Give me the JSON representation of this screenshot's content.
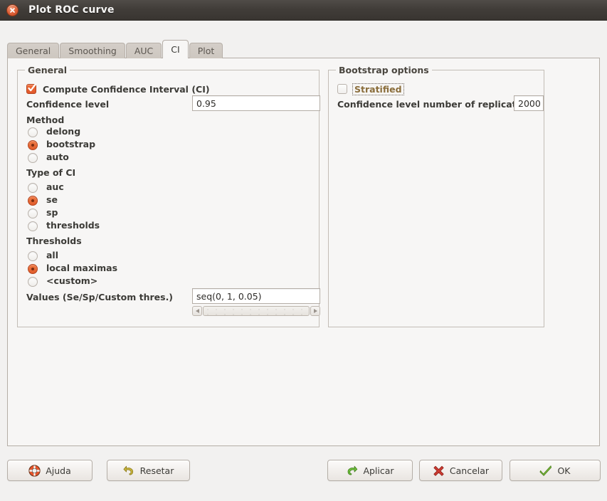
{
  "window": {
    "title": "Plot ROC curve",
    "close_icon": "close-icon"
  },
  "tabs": [
    {
      "label": "General",
      "active": false
    },
    {
      "label": "Smoothing",
      "active": false
    },
    {
      "label": "AUC",
      "active": false
    },
    {
      "label": "CI",
      "active": true
    },
    {
      "label": "Plot",
      "active": false
    }
  ],
  "general_group": {
    "title": "General",
    "compute_ci_label": "Compute Confidence Interval (CI)",
    "compute_ci_checked": true,
    "confidence_level_label": "Confidence level",
    "confidence_level_value": "0.95",
    "method_label": "Method",
    "method_options": [
      {
        "label": "delong",
        "selected": false
      },
      {
        "label": "bootstrap",
        "selected": true
      },
      {
        "label": "auto",
        "selected": false
      }
    ],
    "type_of_ci_label": "Type of CI",
    "type_of_ci_options": [
      {
        "label": "auc",
        "selected": false
      },
      {
        "label": "se",
        "selected": true
      },
      {
        "label": "sp",
        "selected": false
      },
      {
        "label": "thresholds",
        "selected": false
      }
    ],
    "thresholds_label": "Thresholds",
    "thresholds_options": [
      {
        "label": "all",
        "selected": false
      },
      {
        "label": "local maximas",
        "selected": true
      },
      {
        "label": "<custom>",
        "selected": false
      }
    ],
    "values_label": "Values (Se/Sp/Custom thres.)",
    "values_value": "seq(0, 1, 0.05)"
  },
  "bootstrap_group": {
    "title": "Bootstrap options",
    "stratified_label": "Stratified",
    "stratified_checked": false,
    "replicates_label": "Confidence level number of replicates",
    "replicates_value": "2000"
  },
  "buttons": {
    "help": "Ajuda",
    "reset": "Resetar",
    "apply": "Aplicar",
    "cancel": "Cancelar",
    "ok": "OK"
  },
  "colors": {
    "accent_orange": "#e0562a",
    "titlebar": "#413d39",
    "page_bg": "#f2f1f0",
    "panel_bg": "#f7f6f5",
    "apply_green": "#6aa832",
    "cancel_red": "#c0392b",
    "ok_green": "#7cb342",
    "reset_gold": "#b8a633"
  }
}
